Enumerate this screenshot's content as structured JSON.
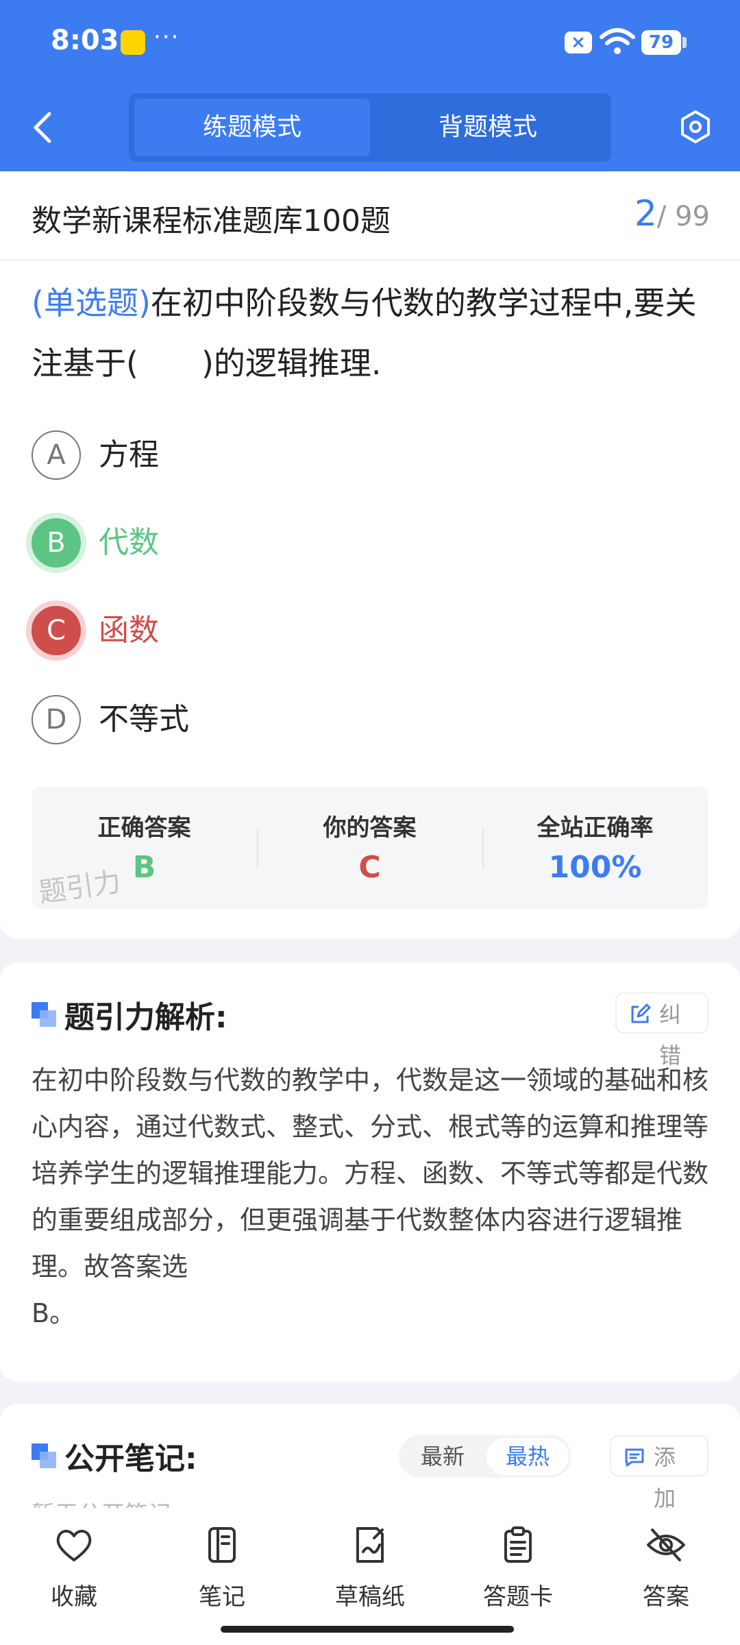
{
  "status": {
    "time": "8:03",
    "dots": "···",
    "battery": "79",
    "close_badge": "×"
  },
  "header": {
    "modes": [
      "练题模式",
      "背题模式"
    ],
    "active_mode": "练题模式"
  },
  "bank": {
    "title": "数学新课程标准题库100题",
    "current": "2",
    "total": "/ 99"
  },
  "question": {
    "type": "(单选题)",
    "text": "在初中阶段数与代数的教学过程中,要关注基于(　　)的逻辑推理.",
    "options": [
      {
        "letter": "A",
        "text": "方程",
        "state": "normal"
      },
      {
        "letter": "B",
        "text": "代数",
        "state": "correct"
      },
      {
        "letter": "C",
        "text": "函数",
        "state": "wrong"
      },
      {
        "letter": "D",
        "text": "不等式",
        "state": "normal"
      }
    ]
  },
  "result": {
    "correct_label": "正确答案",
    "correct_value": "B",
    "yours_label": "你的答案",
    "yours_value": "C",
    "rate_label": "全站正确率",
    "rate_value": "100%",
    "watermark": "题引力"
  },
  "analysis": {
    "title": "题引力解析:",
    "report_label": "纠错",
    "text": "在初中阶段数与代数的教学中，代数是这一领域的基础和核心内容，通过代数式、整式、分式、根式等的运算和推理等培养学生的逻辑推理能力。方程、函数、不等式等都是代数的重要组成部分，但更强调基于代数整体内容进行逻辑推理。故答案选",
    "text_tail": "B。"
  },
  "notes": {
    "title": "公开笔记:",
    "sort_options": [
      "最新",
      "最热"
    ],
    "active_sort": "最热",
    "add_label": "添加",
    "empty_text": "暂无公开笔记"
  },
  "bottom_nav": {
    "items": [
      {
        "label": "收藏",
        "icon": "heart-icon"
      },
      {
        "label": "笔记",
        "icon": "notebook-icon"
      },
      {
        "label": "草稿纸",
        "icon": "draft-icon"
      },
      {
        "label": "答题卡",
        "icon": "answer-sheet-icon"
      },
      {
        "label": "答案",
        "icon": "eye-off-icon"
      }
    ]
  },
  "colors": {
    "primary": "#3d7cf0",
    "correct": "#5cc583",
    "wrong": "#cf4d4a"
  }
}
